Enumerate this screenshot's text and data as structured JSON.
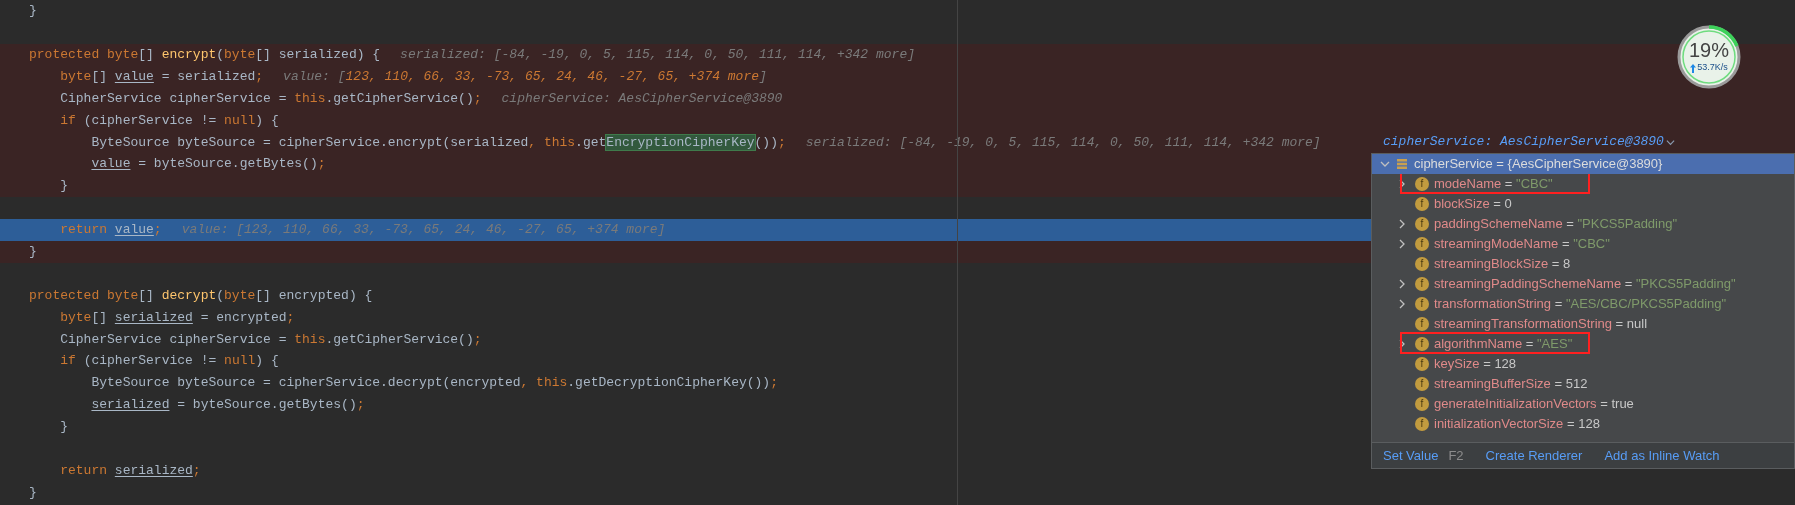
{
  "editor": {
    "lines": [
      {
        "kind": "code",
        "breakpoint": false,
        "current_line": false,
        "tokens": [
          {
            "text": "}",
            "kind": "plain"
          }
        ]
      },
      {
        "kind": "blank"
      },
      {
        "kind": "code",
        "breakpoint": true,
        "current_line": false,
        "tokens": [
          {
            "text": "protected byte",
            "kind": "kw"
          },
          {
            "text": "[] ",
            "kind": "plain"
          },
          {
            "text": "encrypt",
            "kind": "fn"
          },
          {
            "text": "(",
            "kind": "plain"
          },
          {
            "text": "byte",
            "kind": "kw"
          },
          {
            "text": "[] serialized) {",
            "kind": "plain"
          }
        ],
        "hint": [
          {
            "text": "serialized: [-84, -19, 0, 5, 115, 114, 0, 50, 111, 114, +342 more]",
            "kind": "hint"
          }
        ]
      },
      {
        "kind": "code",
        "breakpoint": true,
        "current_line": false,
        "tokens": [
          {
            "text": "    byte",
            "kind": "kw"
          },
          {
            "text": "[] ",
            "kind": "plain"
          },
          {
            "text": "value",
            "kind": "var"
          },
          {
            "text": " = serialized",
            "kind": "plain"
          },
          {
            "text": ";",
            "kind": "kw"
          }
        ],
        "hint": [
          {
            "text": "value: [",
            "kind": "hint"
          },
          {
            "text": "123, 110, 66, 33, -73, 65, 24, 46, -27, 65, +374 more",
            "kind": "hintnum"
          },
          {
            "text": "]",
            "kind": "hint"
          }
        ]
      },
      {
        "kind": "code",
        "breakpoint": true,
        "current_line": false,
        "tokens": [
          {
            "text": "    CipherService cipherService = ",
            "kind": "plain"
          },
          {
            "text": "this",
            "kind": "kw"
          },
          {
            "text": ".getCipherService()",
            "kind": "plain"
          },
          {
            "text": ";",
            "kind": "kw"
          }
        ],
        "hint": [
          {
            "text": "cipherService: AesCipherService@3890",
            "kind": "hint"
          }
        ]
      },
      {
        "kind": "code",
        "breakpoint": true,
        "current_line": false,
        "tokens": [
          {
            "text": "    if",
            "kind": "kw"
          },
          {
            "text": " (cipherService != ",
            "kind": "plain"
          },
          {
            "text": "null",
            "kind": "kw"
          },
          {
            "text": ") {",
            "kind": "plain"
          }
        ]
      },
      {
        "kind": "code",
        "breakpoint": true,
        "current_line": false,
        "tokens": [
          {
            "text": "        ByteSource byteSource = cipherService.encrypt(serialized",
            "kind": "plain"
          },
          {
            "text": ", this",
            "kind": "kw"
          },
          {
            "text": ".get",
            "kind": "plain"
          },
          {
            "text": "EncryptionCipherKey",
            "kind": "match"
          },
          {
            "text": "())",
            "kind": "plain"
          },
          {
            "text": ";",
            "kind": "kw"
          }
        ],
        "hint": [
          {
            "text": "serialized: [-84, -19, 0, 5, 115, 114, 0, 50, 111, 114, +342 more]",
            "kind": "hint"
          }
        ]
      },
      {
        "kind": "code",
        "breakpoint": true,
        "current_line": false,
        "tokens": [
          {
            "text": "        value",
            "kind": "var"
          },
          {
            "text": " = byteSource.getBytes()",
            "kind": "plain"
          },
          {
            "text": ";",
            "kind": "kw"
          }
        ]
      },
      {
        "kind": "code",
        "breakpoint": true,
        "current_line": false,
        "tokens": [
          {
            "text": "    }",
            "kind": "plain"
          }
        ]
      },
      {
        "kind": "blank"
      },
      {
        "kind": "code",
        "current_line": true,
        "tokens": [
          {
            "text": "    return ",
            "kind": "kw"
          },
          {
            "text": "value",
            "kind": "var"
          },
          {
            "text": ";",
            "kind": "kw"
          }
        ],
        "hint": [
          {
            "text": "value: [123, 110, 66, 33, -73, 65, 24, 46, -27, 65, +374 more]",
            "kind": "hint"
          }
        ]
      },
      {
        "kind": "code",
        "breakpoint": true,
        "current_line": false,
        "tokens": [
          {
            "text": "}",
            "kind": "plain"
          }
        ]
      },
      {
        "kind": "blank"
      },
      {
        "kind": "code",
        "breakpoint": false,
        "current_line": false,
        "tokens": [
          {
            "text": "protected byte",
            "kind": "kw"
          },
          {
            "text": "[] ",
            "kind": "plain"
          },
          {
            "text": "decrypt",
            "kind": "fn"
          },
          {
            "text": "(",
            "kind": "plain"
          },
          {
            "text": "byte",
            "kind": "kw"
          },
          {
            "text": "[] encrypted) {",
            "kind": "plain"
          }
        ]
      },
      {
        "kind": "code",
        "breakpoint": false,
        "current_line": false,
        "tokens": [
          {
            "text": "    byte",
            "kind": "kw"
          },
          {
            "text": "[] ",
            "kind": "plain"
          },
          {
            "text": "serialized",
            "kind": "var"
          },
          {
            "text": " = encrypted",
            "kind": "plain"
          },
          {
            "text": ";",
            "kind": "kw"
          }
        ]
      },
      {
        "kind": "code",
        "breakpoint": false,
        "current_line": false,
        "tokens": [
          {
            "text": "    CipherService cipherService = ",
            "kind": "plain"
          },
          {
            "text": "this",
            "kind": "kw"
          },
          {
            "text": ".getCipherService()",
            "kind": "plain"
          },
          {
            "text": ";",
            "kind": "kw"
          }
        ]
      },
      {
        "kind": "code",
        "breakpoint": false,
        "current_line": false,
        "tokens": [
          {
            "text": "    if",
            "kind": "kw"
          },
          {
            "text": " (cipherService != ",
            "kind": "plain"
          },
          {
            "text": "null",
            "kind": "kw"
          },
          {
            "text": ") {",
            "kind": "plain"
          }
        ]
      },
      {
        "kind": "code",
        "breakpoint": false,
        "current_line": false,
        "tokens": [
          {
            "text": "        ByteSource byteSource = cipherService.decrypt(encrypted",
            "kind": "plain"
          },
          {
            "text": ", this",
            "kind": "kw"
          },
          {
            "text": ".getDecryptionCipherKey())",
            "kind": "plain"
          },
          {
            "text": ";",
            "kind": "kw"
          }
        ]
      },
      {
        "kind": "code",
        "breakpoint": false,
        "current_line": false,
        "tokens": [
          {
            "text": "        serialized",
            "kind": "var"
          },
          {
            "text": " = byteSource.getBytes()",
            "kind": "plain"
          },
          {
            "text": ";",
            "kind": "kw"
          }
        ]
      },
      {
        "kind": "code",
        "breakpoint": false,
        "current_line": false,
        "tokens": [
          {
            "text": "    }",
            "kind": "plain"
          }
        ]
      },
      {
        "kind": "blank"
      },
      {
        "kind": "code",
        "breakpoint": false,
        "current_line": false,
        "tokens": [
          {
            "text": "    return ",
            "kind": "kw"
          },
          {
            "text": "serialized",
            "kind": "var"
          },
          {
            "text": ";",
            "kind": "kw"
          }
        ]
      },
      {
        "kind": "code",
        "breakpoint": false,
        "current_line": false,
        "tokens": [
          {
            "text": "}",
            "kind": "plain"
          }
        ]
      }
    ]
  },
  "popup": {
    "title": "cipherService: AesCipherService@3890",
    "root": {
      "label": "cipherService = {AesCipherService@3890}",
      "expanded": true,
      "selected": true
    },
    "fields": [
      {
        "icon": "f",
        "name": "modeName",
        "operator": "=",
        "value": "\"CBC\"",
        "kind": "string",
        "expandable": true,
        "boxed": true
      },
      {
        "icon": "f",
        "name": "blockSize",
        "operator": "=",
        "value": "0",
        "kind": "plain",
        "expandable": false,
        "boxed": false
      },
      {
        "icon": "f",
        "name": "paddingSchemeName",
        "operator": "=",
        "value": "\"PKCS5Padding\"",
        "kind": "string",
        "expandable": true,
        "boxed": false
      },
      {
        "icon": "f",
        "name": "streamingModeName",
        "operator": "=",
        "value": "\"CBC\"",
        "kind": "string",
        "expandable": true,
        "boxed": false
      },
      {
        "icon": "f",
        "name": "streamingBlockSize",
        "operator": "=",
        "value": "8",
        "kind": "plain",
        "expandable": false,
        "boxed": false
      },
      {
        "icon": "f",
        "name": "streamingPaddingSchemeName",
        "operator": "=",
        "value": "\"PKCS5Padding\"",
        "kind": "string",
        "expandable": true,
        "boxed": false
      },
      {
        "icon": "f",
        "name": "transformationString",
        "operator": "=",
        "value": "\"AES/CBC/PKCS5Padding\"",
        "kind": "string",
        "expandable": true,
        "boxed": false
      },
      {
        "icon": "f",
        "name": "streamingTransformationString",
        "operator": "=",
        "value": "null",
        "kind": "plain",
        "expandable": false,
        "boxed": false
      },
      {
        "icon": "f",
        "name": "algorithmName",
        "operator": "=",
        "value": "\"AES\"",
        "kind": "string",
        "expandable": true,
        "boxed": true
      },
      {
        "icon": "f",
        "name": "keySize",
        "operator": "=",
        "value": "128",
        "kind": "plain",
        "expandable": false,
        "boxed": false
      },
      {
        "icon": "f",
        "name": "streamingBufferSize",
        "operator": "=",
        "value": "512",
        "kind": "plain",
        "expandable": false,
        "boxed": false
      },
      {
        "icon": "f",
        "name": "generateInitializationVectors",
        "operator": "=",
        "value": "true",
        "kind": "plain",
        "expandable": false,
        "boxed": false
      },
      {
        "icon": "f",
        "name": "initializationVectorSize",
        "operator": "=",
        "value": "128",
        "kind": "plain",
        "expandable": false,
        "boxed": false
      }
    ],
    "actions": [
      {
        "label": "Set Value",
        "shortcut": "F2"
      },
      {
        "label": "Create Renderer"
      },
      {
        "label": "Add as Inline Watch"
      }
    ]
  },
  "network_badge": {
    "percent": "19%",
    "level": 0.19,
    "speed": "53.7K/s"
  }
}
